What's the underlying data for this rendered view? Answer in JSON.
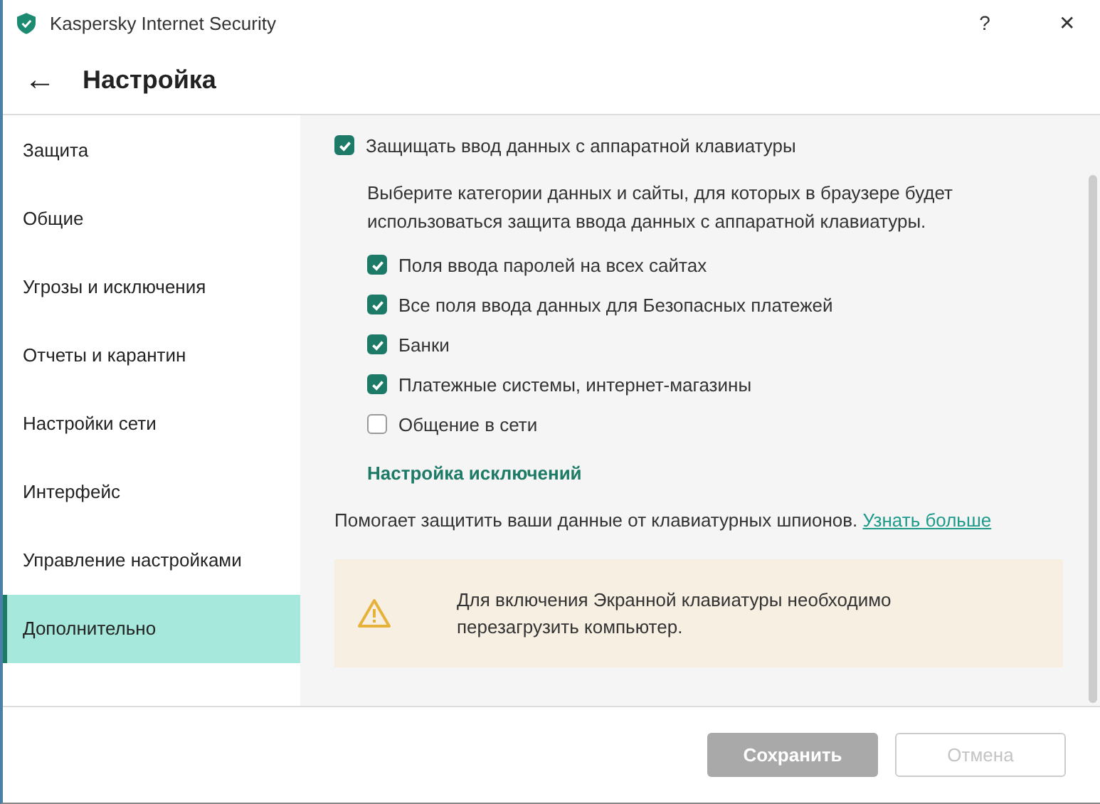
{
  "window": {
    "title": "Kaspersky Internet Security",
    "help": "?",
    "close": "✕"
  },
  "header": {
    "back": "←",
    "title": "Настройка"
  },
  "sidebar": {
    "items": [
      {
        "label": "Защита",
        "selected": false
      },
      {
        "label": "Общие",
        "selected": false
      },
      {
        "label": "Угрозы и исключения",
        "selected": false
      },
      {
        "label": "Отчеты и карантин",
        "selected": false
      },
      {
        "label": "Настройки сети",
        "selected": false
      },
      {
        "label": "Интерфейс",
        "selected": false
      },
      {
        "label": "Управление настройками",
        "selected": false
      },
      {
        "label": "Дополнительно",
        "selected": true
      }
    ]
  },
  "content": {
    "main_option": {
      "label": "Защищать ввод данных с аппаратной клавиатуры",
      "checked": true
    },
    "description": "Выберите категории данных и сайты, для которых в браузере будет использоваться защита ввода данных с аппаратной клавиатуры.",
    "options": [
      {
        "label": "Поля ввода паролей на всех сайтах",
        "checked": true
      },
      {
        "label": "Все поля ввода данных для Безопасных платежей",
        "checked": true
      },
      {
        "label": "Банки",
        "checked": true
      },
      {
        "label": "Платежные системы, интернет-магазины",
        "checked": true
      },
      {
        "label": "Общение в сети",
        "checked": false
      }
    ],
    "exclusions_link": "Настройка исключений",
    "info": "Помогает защитить ваши данные от клавиатурных шпионов.",
    "learn_more": "Узнать больше",
    "warning": "Для включения Экранной клавиатуры необходимо перезагрузить компьютер."
  },
  "footer": {
    "buttons": [
      {
        "label": "Сохранить",
        "kind": "primary",
        "disabled": true
      },
      {
        "label": "Отмена",
        "kind": "secondary",
        "disabled": true
      }
    ]
  }
}
